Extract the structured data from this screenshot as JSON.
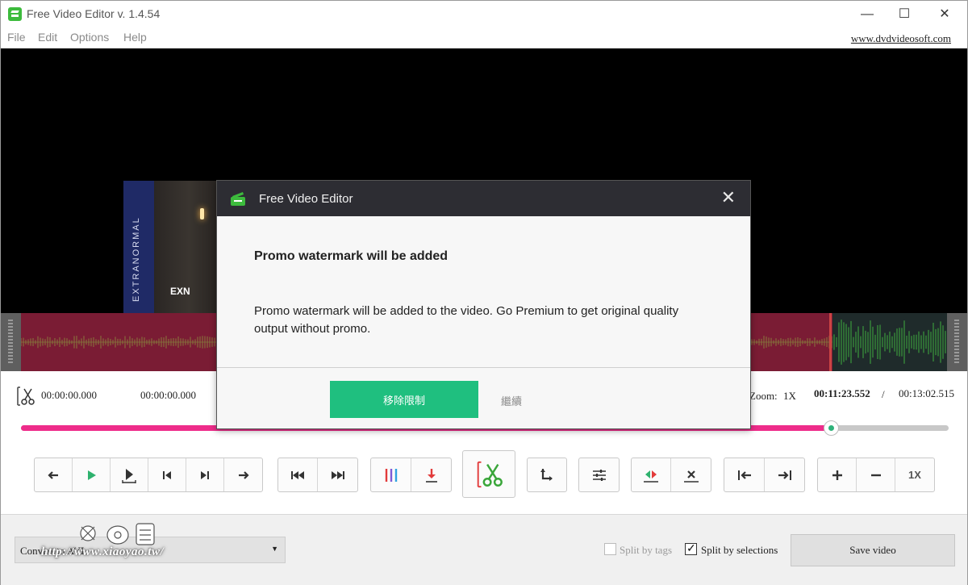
{
  "window": {
    "title": "Free Video Editor v. 1.4.54",
    "minimize_icon": "—",
    "maximize_icon": "☐",
    "close_icon": "✕"
  },
  "menu": {
    "items": [
      "File",
      "Edit",
      "Options",
      "Help"
    ],
    "site_link": "www.dvdvideosoft.com"
  },
  "timecodes": {
    "selection_start": "00:00:00.000",
    "selection_end": "00:00:00.000",
    "zoom_label": "Zoom:",
    "zoom_value": "1X",
    "current": "00:11:23.552",
    "separator": "/",
    "total": "00:13:02.515"
  },
  "progress": {
    "fraction": 0.874
  },
  "toolbar": {
    "zoom_button": "1X"
  },
  "bottom": {
    "format_value": "Convert to AVI",
    "watermark_text": "http://www.xiaoyao.tw/",
    "split_by_tags": "Split by tags",
    "split_by_selections": "Split by selections",
    "save_button": "Save video"
  },
  "thumbnail": {
    "band_text": "EXTRANORMAL",
    "logo_text": "EXN"
  },
  "modal": {
    "title": "Free Video Editor",
    "close": "✕",
    "heading": "Promo watermark will be added",
    "body": "Promo watermark will be added to the video. Go Premium to get original quality output without promo.",
    "primary_button": "移除限制",
    "secondary_button": "繼續"
  },
  "colors": {
    "accent_green": "#1fbf7f",
    "progress_pink": "#ee2c8a",
    "timeline_red": "#7a1c34"
  }
}
